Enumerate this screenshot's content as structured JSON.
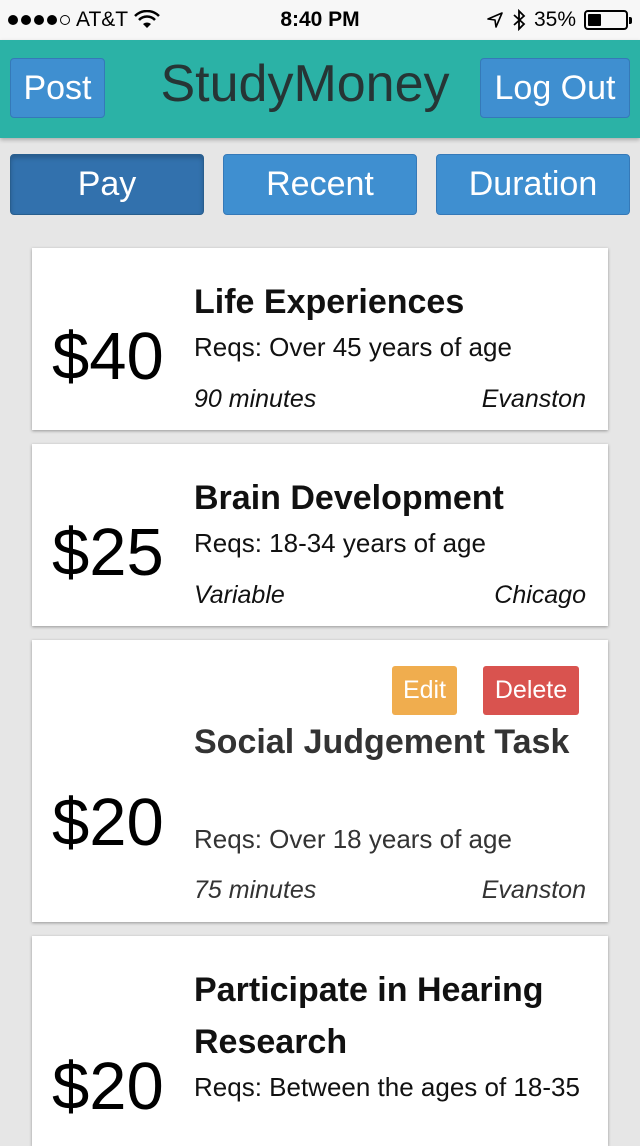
{
  "status_bar": {
    "carrier": "AT&T",
    "time": "8:40 PM",
    "battery": "35%",
    "battery_level": 0.35,
    "icons": [
      "signal-dots-icon",
      "wifi-icon",
      "location-arrow-icon",
      "bluetooth-icon",
      "battery-icon"
    ]
  },
  "header": {
    "title": "StudyMoney",
    "post_label": "Post",
    "logout_label": "Log Out"
  },
  "sort": {
    "pay_label": "Pay",
    "recent_label": "Recent",
    "duration_label": "Duration",
    "active": "Pay"
  },
  "studies": [
    {
      "price": "$40",
      "title": "Life Experiences",
      "reqs": "Reqs: Over 45 years of age",
      "duration": "90 minutes",
      "location": "Evanston"
    },
    {
      "price": "$25",
      "title": "Brain Development",
      "reqs": "Reqs: 18-34 years of age",
      "duration": "Variable",
      "location": "Chicago"
    },
    {
      "price": "$20",
      "title": "Social Judgement Task",
      "reqs": "Reqs: Over 18 years of age",
      "duration": "75 minutes",
      "location": "Evanston",
      "edit_label": "Edit",
      "delete_label": "Delete"
    },
    {
      "price": "$20",
      "title": "Participate in Hearing Research",
      "reqs": "Reqs: Between the ages of 18-35"
    }
  ],
  "colors": {
    "header_bg": "#2bb2a6",
    "button_blue": "#3f8fd0",
    "active_blue": "#3271ad",
    "edit_orange": "#f0ad4e",
    "delete_red": "#d9534f"
  }
}
